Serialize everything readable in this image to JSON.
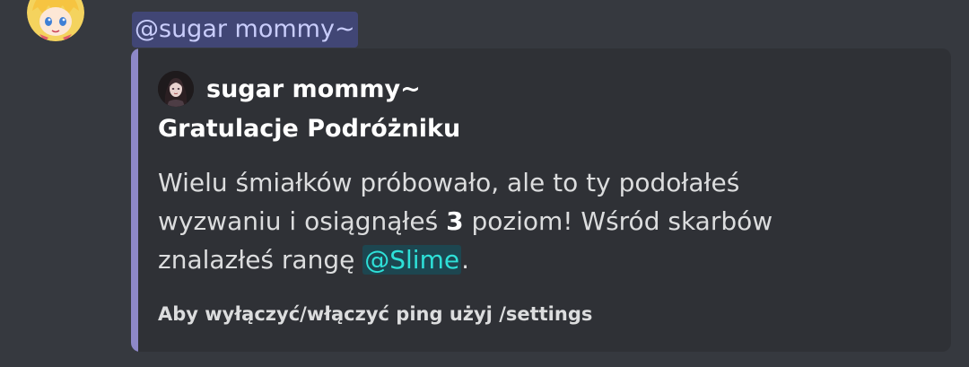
{
  "message": {
    "mention": "@sugar mommy~"
  },
  "embed": {
    "accent_color": "#8e88c8",
    "author": {
      "name": "sugar mommy~",
      "avatar_icon": "author-avatar-icon"
    },
    "title": "Gratulacje Podróżniku",
    "description": {
      "line1": "Wielu śmiałków próbowało, ale to ty podołałeś",
      "line2_before": "wyzwaniu i osiągnąłeś ",
      "level": "3",
      "line2_after": " poziom!  Wśród skarbów",
      "line3_before": "znalazłeś rangę ",
      "role_mention": "@Slime",
      "line3_after": "."
    },
    "footer": "Aby wyłączyć/włączyć ping użyj /settings"
  },
  "colors": {
    "background": "#36393f",
    "embed_background": "#2f3136",
    "user_mention_bg": "#414675",
    "user_mention_text": "#c9cdfb",
    "role_mention_bg": "#1d4650",
    "role_mention_text": "#2ee0d8"
  }
}
